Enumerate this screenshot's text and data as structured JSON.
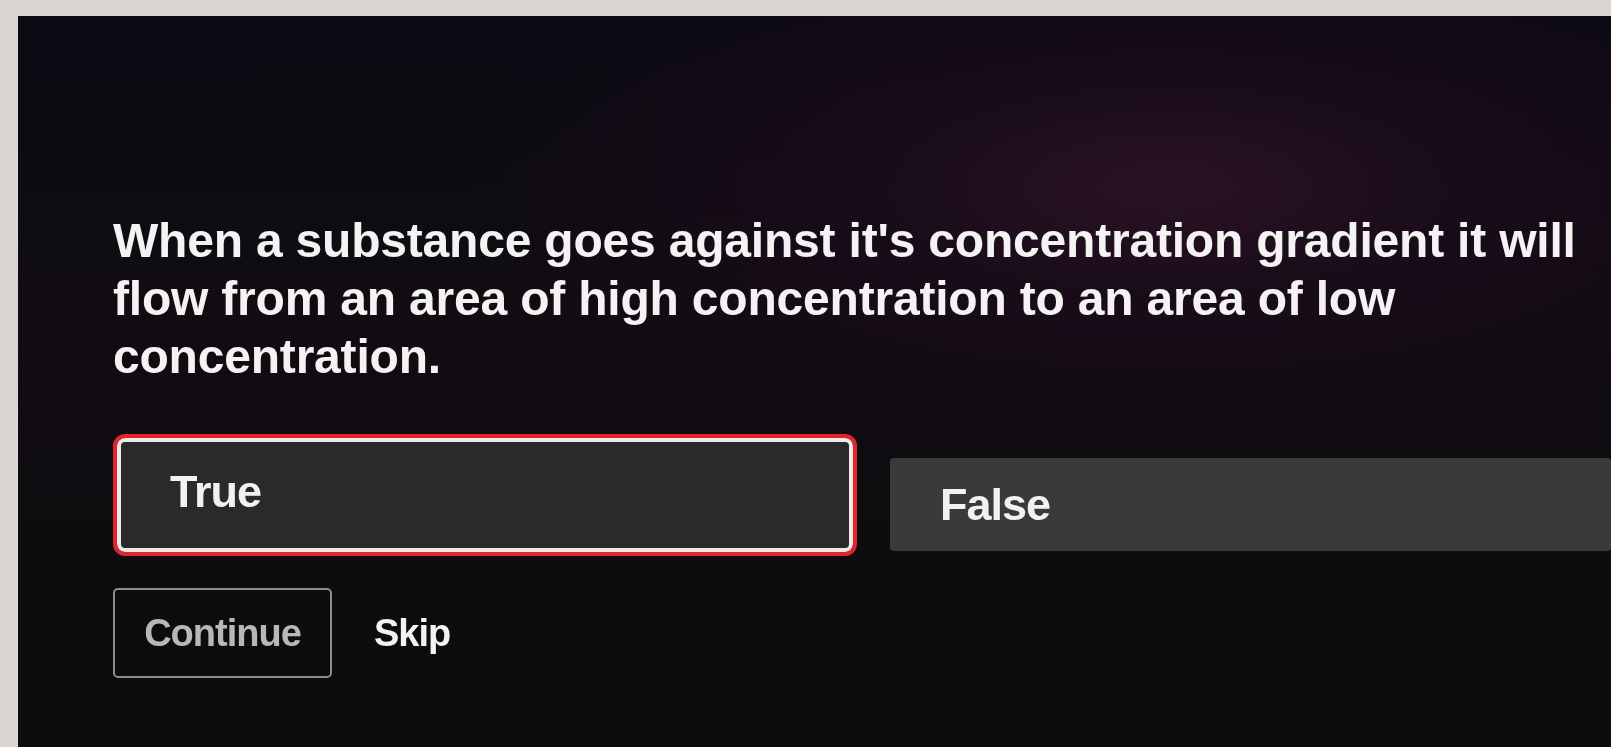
{
  "question": {
    "text": "When a substance goes against it's concentration gradient it will flow from an area of high concentration to an area of low concentration."
  },
  "options": [
    {
      "label": "True",
      "selected": true
    },
    {
      "label": "False",
      "selected": false
    }
  ],
  "actions": [
    {
      "kind": "outlined",
      "label": "Continue"
    },
    {
      "kind": "link",
      "label": "Skip"
    }
  ]
}
